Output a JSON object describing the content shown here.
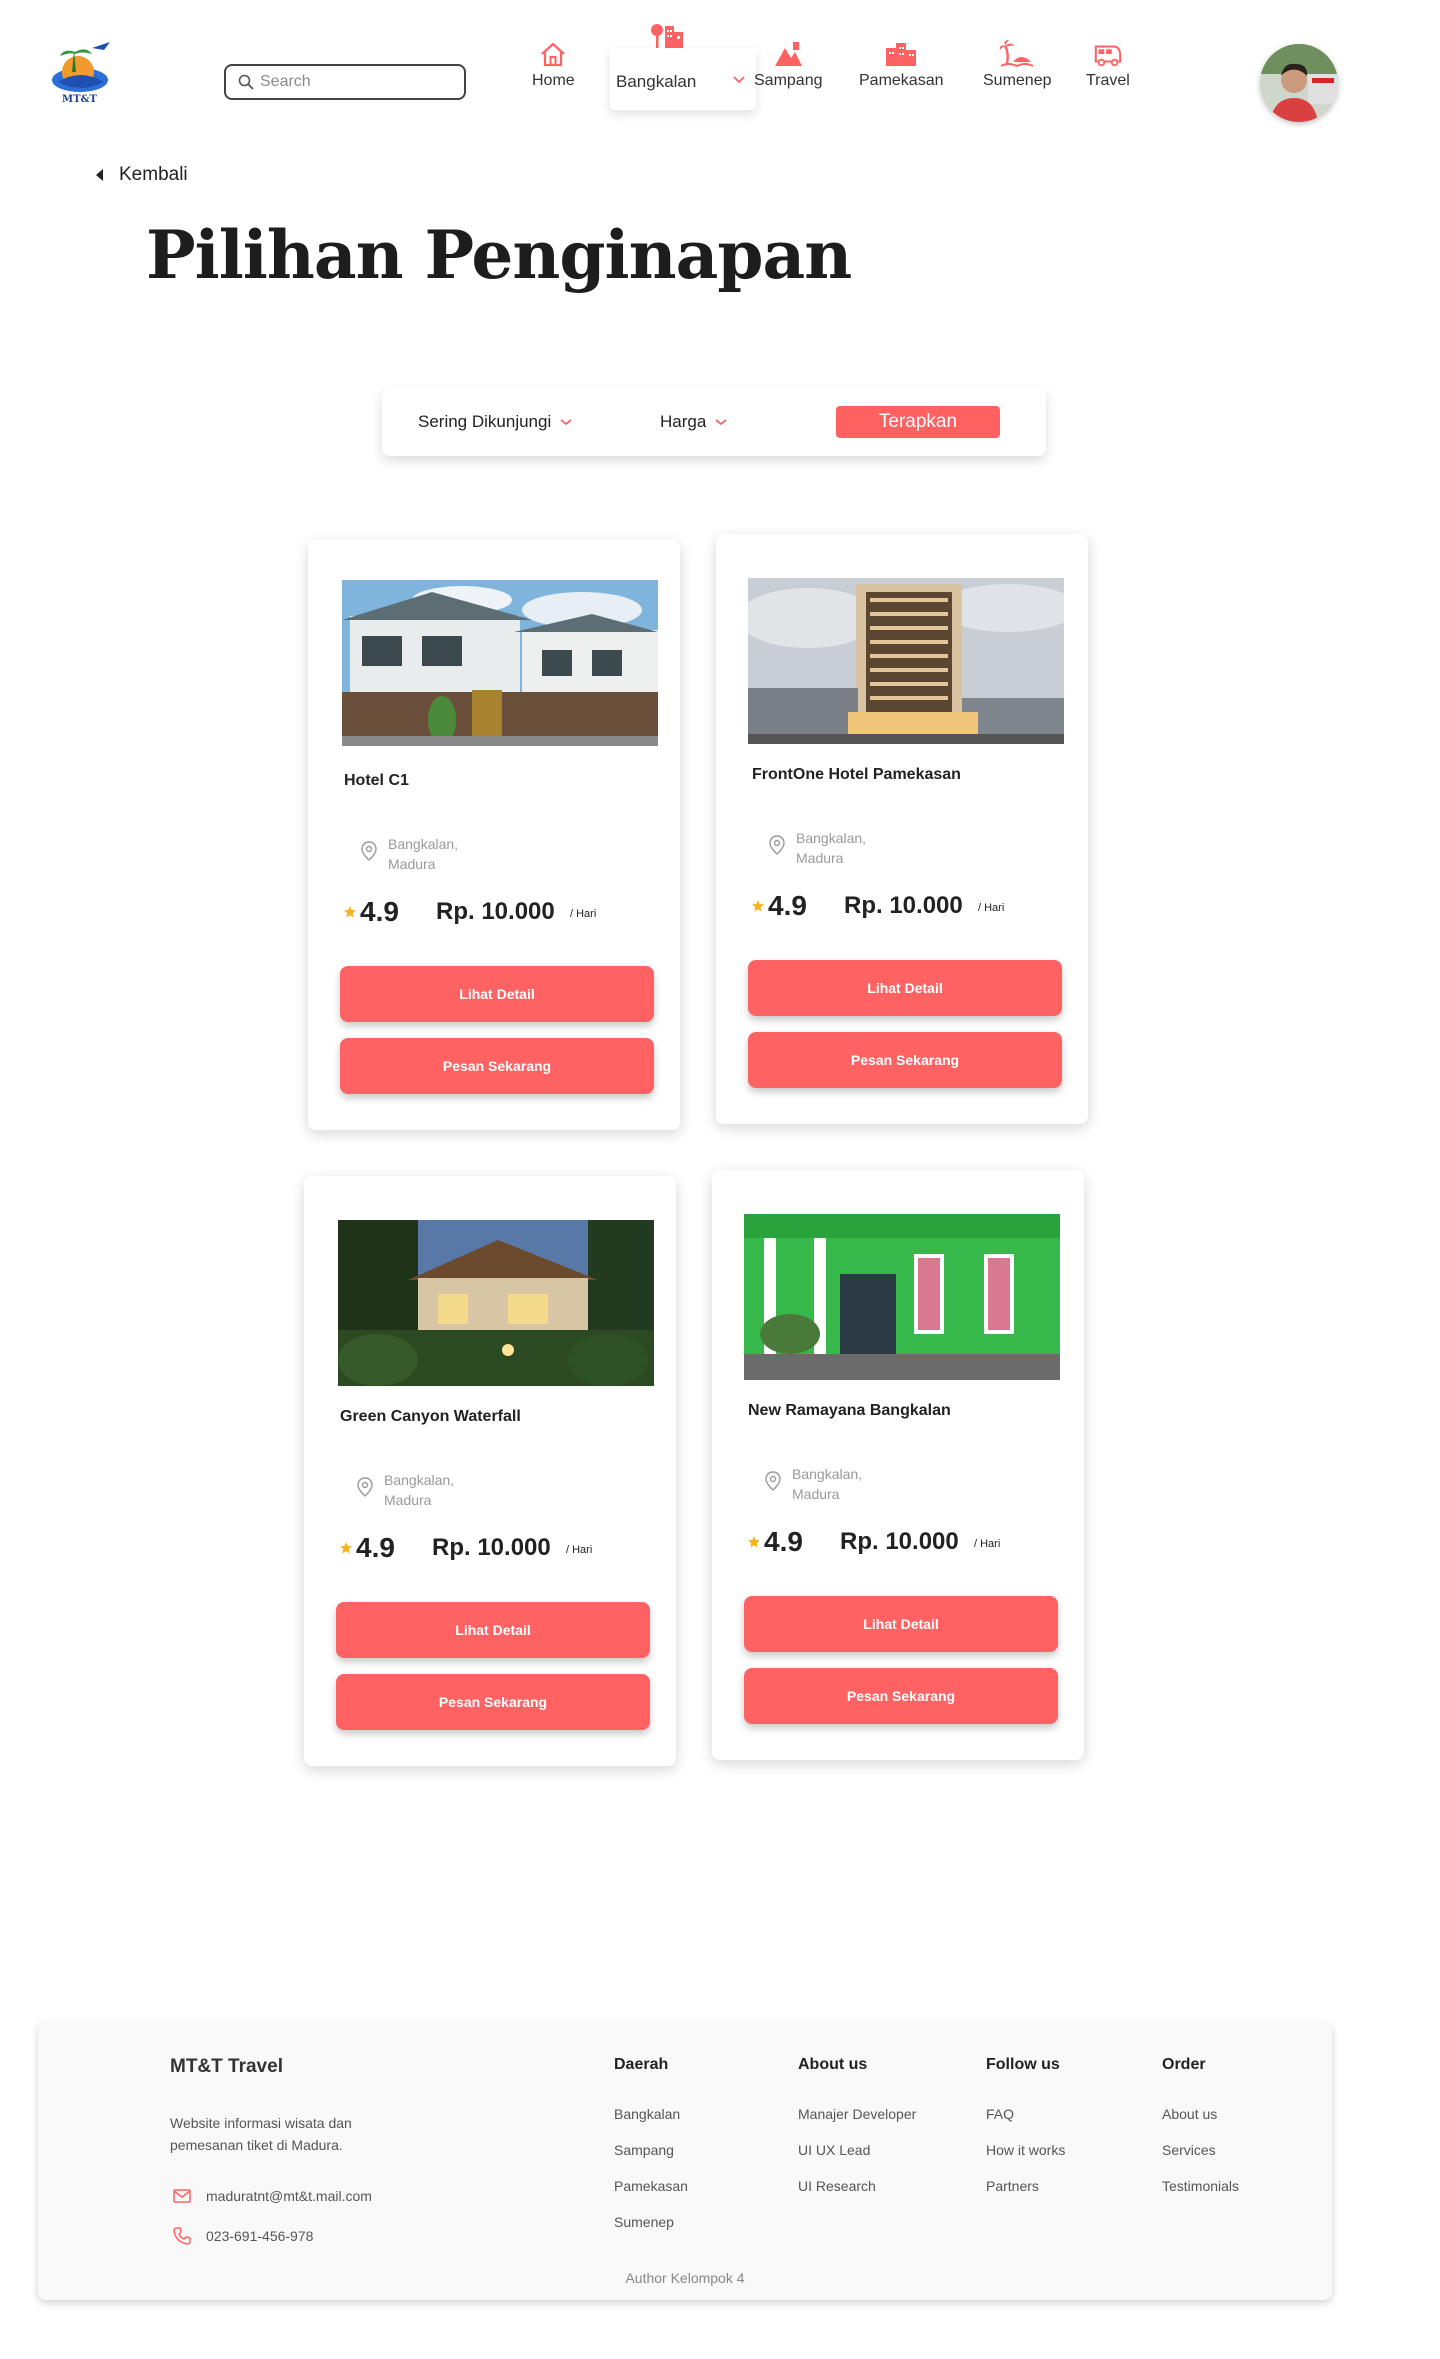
{
  "header": {
    "logo_text": "MT&T",
    "search": {
      "placeholder": "Search"
    },
    "nav": [
      {
        "label": "Home",
        "icon": "home-icon"
      },
      {
        "label": "Sampang",
        "icon": "mountain-icon"
      },
      {
        "label": "Pamekasan",
        "icon": "buildings-icon"
      },
      {
        "label": "Sumenep",
        "icon": "beach-icon"
      },
      {
        "label": "Travel",
        "icon": "bus-icon"
      }
    ],
    "region_dropdown": {
      "label": "Bangkalan",
      "icon": "tree-building-icon"
    },
    "avatar": "user-avatar"
  },
  "back_label": "Kembali",
  "page_title": "Pilihan Penginapan",
  "filters": {
    "popular": "Sering Dikunjungi",
    "price": "Harga",
    "apply": "Terapkan"
  },
  "colors": {
    "accent": "#ff6262",
    "star": "#f6b21b"
  },
  "cards": [
    {
      "name": "Hotel C1",
      "loc_line1": "Bangkalan,",
      "loc_line2": "Madura",
      "rating": "4.9",
      "price": "Rp. 10.000",
      "unit": "/ Hari",
      "detail_label": "Lihat Detail",
      "book_label": "Pesan Sekarang"
    },
    {
      "name": "FrontOne Hotel Pamekasan",
      "loc_line1": "Bangkalan,",
      "loc_line2": "Madura",
      "rating": "4.9",
      "price": "Rp. 10.000",
      "unit": "/ Hari",
      "detail_label": "Lihat Detail",
      "book_label": "Pesan Sekarang"
    },
    {
      "name": "Green Canyon Waterfall",
      "loc_line1": "Bangkalan,",
      "loc_line2": "Madura",
      "rating": "4.9",
      "price": "Rp. 10.000",
      "unit": "/ Hari",
      "detail_label": "Lihat Detail",
      "book_label": "Pesan Sekarang"
    },
    {
      "name": "New Ramayana Bangkalan",
      "loc_line1": "Bangkalan,",
      "loc_line2": "Madura",
      "rating": "4.9",
      "price": "Rp. 10.000",
      "unit": "/ Hari",
      "detail_label": "Lihat Detail",
      "book_label": "Pesan Sekarang"
    }
  ],
  "footer": {
    "brand": "MT&T Travel",
    "description": "Website informasi wisata dan pemesanan tiket di Madura.",
    "email": "maduratnt@mt&t.mail.com",
    "phone": "023-691-456-978",
    "columns": [
      {
        "head": "Daerah",
        "links": [
          "Bangkalan",
          "Sampang",
          "Pamekasan",
          "Sumenep"
        ]
      },
      {
        "head": "About us",
        "links": [
          "Manajer Developer",
          "UI UX Lead",
          "UI Research"
        ]
      },
      {
        "head": "Follow us",
        "links": [
          "FAQ",
          "How it works",
          "Partners"
        ]
      },
      {
        "head": "Order",
        "links": [
          "About us",
          "Services",
          "Testimonials"
        ]
      }
    ],
    "author": "Author Kelompok 4"
  }
}
